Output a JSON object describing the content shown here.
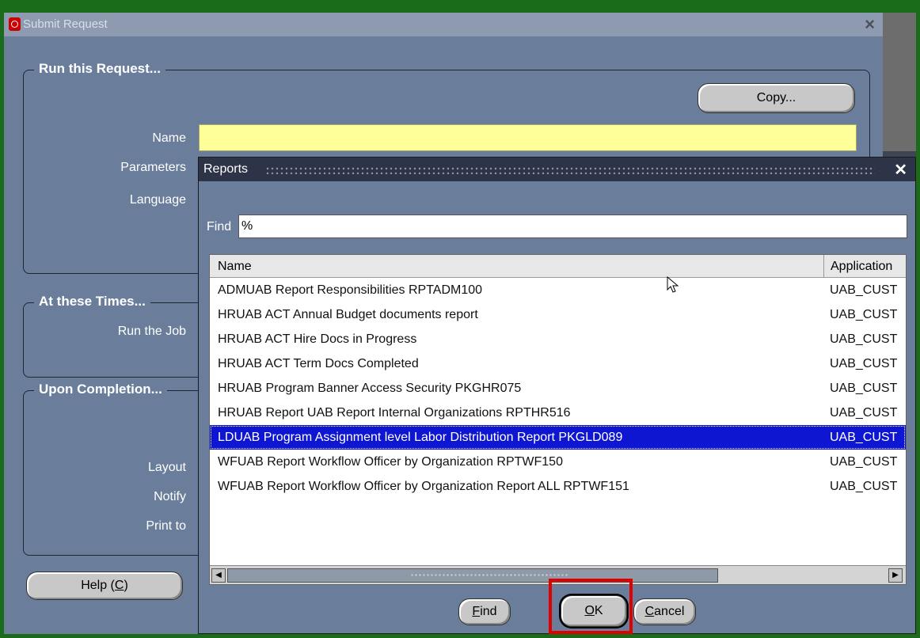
{
  "main_window": {
    "title": "Submit Request",
    "close_icon": "×",
    "run_group_title": "Run this Request...",
    "copy_label": "Copy...",
    "name_label": "Name",
    "parameters_label": "Parameters",
    "language_label": "Language",
    "times_group_title": "At these Times...",
    "run_job_label": "Run the Job",
    "completion_group_title": "Upon Completion...",
    "layout_label": "Layout",
    "notify_label": "Notify",
    "print_to_label": "Print to",
    "help_label_prefix": "Help (",
    "help_label_key": "C",
    "help_label_suffix": ")"
  },
  "dialog": {
    "title": "Reports",
    "close_icon": "✕",
    "find_label": "Find",
    "find_value": "%",
    "columns": {
      "name": "Name",
      "application": "Application"
    },
    "rows": [
      {
        "name": "ADMUAB Report Responsibilities RPTADM100",
        "application": "UAB_CUST",
        "selected": false
      },
      {
        "name": "HRUAB ACT Annual Budget documents report",
        "application": "UAB_CUST",
        "selected": false
      },
      {
        "name": "HRUAB ACT Hire Docs in Progress",
        "application": "UAB_CUST",
        "selected": false
      },
      {
        "name": "HRUAB ACT Term Docs Completed",
        "application": "UAB_CUST",
        "selected": false
      },
      {
        "name": "HRUAB Program Banner Access Security PKGHR075",
        "application": "UAB_CUST",
        "selected": false
      },
      {
        "name": "HRUAB Report UAB Report Internal Organizations RPTHR516",
        "application": "UAB_CUST",
        "selected": false
      },
      {
        "name": "LDUAB Program Assignment level Labor Distribution Report PKGLD089",
        "application": "UAB_CUST",
        "selected": true
      },
      {
        "name": "WFUAB Report Workflow Officer by Organization RPTWF150",
        "application": "UAB_CUST",
        "selected": false
      },
      {
        "name": "WFUAB Report Workflow Officer by Organization Report ALL RPTWF151",
        "application": "UAB_CUST",
        "selected": false
      }
    ],
    "find_button_key": "F",
    "find_button_rest": "ind",
    "ok_button_key": "O",
    "ok_button_rest": "K",
    "cancel_button_key": "C",
    "cancel_button_rest": "ancel"
  },
  "colors": {
    "window_bg": "#6a7e9c",
    "name_field_bg": "#ffff99",
    "selected_row": "#0e16d1",
    "highlight": "#e00000"
  }
}
